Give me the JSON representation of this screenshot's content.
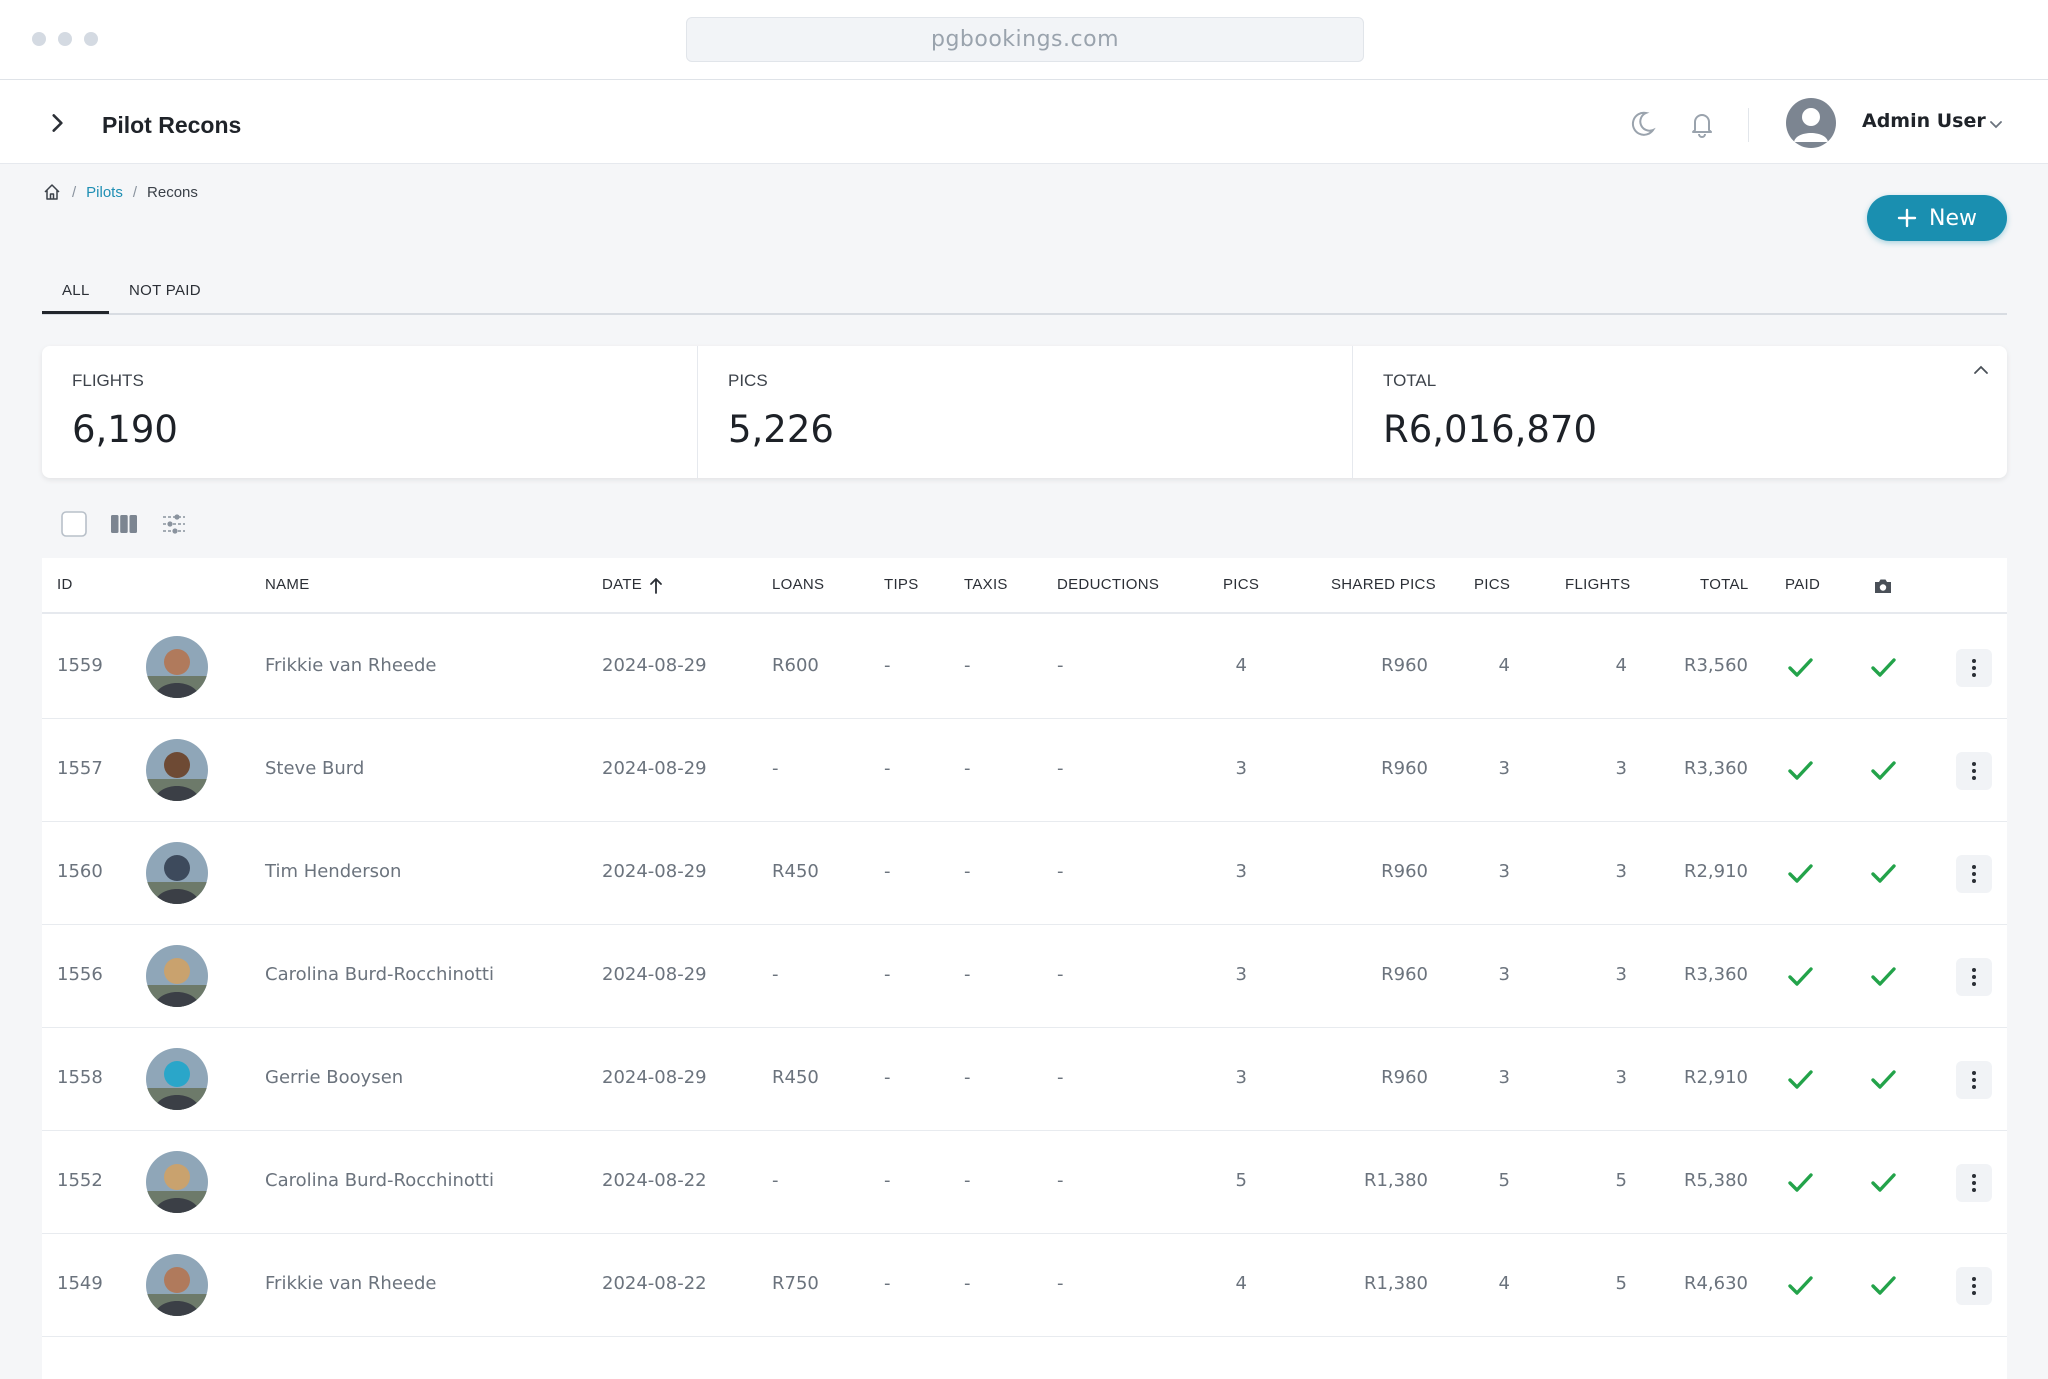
{
  "browser": {
    "url": "pgbookings.com"
  },
  "header": {
    "title": "Pilot Recons",
    "user_name": "Admin User"
  },
  "breadcrumb": {
    "pilots": "Pilots",
    "recons": "Recons",
    "separator": "/"
  },
  "actions": {
    "new_label": "New"
  },
  "tabs": [
    {
      "label": "ALL"
    },
    {
      "label": "NOT PAID"
    }
  ],
  "stats": [
    {
      "label": "FLIGHTS",
      "value": "6,190"
    },
    {
      "label": "PICS",
      "value": "5,226"
    },
    {
      "label": "TOTAL",
      "value": "R6,016,870"
    }
  ],
  "table": {
    "columns": {
      "id": "ID",
      "name": "NAME",
      "date": "DATE",
      "loans": "LOANS",
      "tips": "TIPS",
      "taxis": "TAXIS",
      "deductions": "DEDUCTIONS",
      "pics": "PICS",
      "shared_pics": "SHARED PICS",
      "pics2": "PICS",
      "flights": "FLIGHTS",
      "total": "TOTAL",
      "paid": "PAID"
    },
    "rows": [
      {
        "id": "1559",
        "name": "Frikkie van Rheede",
        "date": "2024-08-29",
        "loans": "R600",
        "tips": "-",
        "taxis": "-",
        "deductions": "-",
        "pics": "4",
        "shared_pics": "R960",
        "pics2": "4",
        "flights": "4",
        "total": "R3,560",
        "photo_color": "#b07a5c"
      },
      {
        "id": "1557",
        "name": "Steve Burd",
        "date": "2024-08-29",
        "loans": "-",
        "tips": "-",
        "taxis": "-",
        "deductions": "-",
        "pics": "3",
        "shared_pics": "R960",
        "pics2": "3",
        "flights": "3",
        "total": "R3,360",
        "photo_color": "#6e4a34"
      },
      {
        "id": "1560",
        "name": "Tim Henderson",
        "date": "2024-08-29",
        "loans": "R450",
        "tips": "-",
        "taxis": "-",
        "deductions": "-",
        "pics": "3",
        "shared_pics": "R960",
        "pics2": "3",
        "flights": "3",
        "total": "R2,910",
        "photo_color": "#3d4a5c"
      },
      {
        "id": "1556",
        "name": "Carolina Burd-Rocchinotti",
        "date": "2024-08-29",
        "loans": "-",
        "tips": "-",
        "taxis": "-",
        "deductions": "-",
        "pics": "3",
        "shared_pics": "R960",
        "pics2": "3",
        "flights": "3",
        "total": "R3,360",
        "photo_color": "#c9a26e"
      },
      {
        "id": "1558",
        "name": "Gerrie Booysen",
        "date": "2024-08-29",
        "loans": "R450",
        "tips": "-",
        "taxis": "-",
        "deductions": "-",
        "pics": "3",
        "shared_pics": "R960",
        "pics2": "3",
        "flights": "3",
        "total": "R2,910",
        "photo_color": "#2aa6c9"
      },
      {
        "id": "1552",
        "name": "Carolina Burd-Rocchinotti",
        "date": "2024-08-22",
        "loans": "-",
        "tips": "-",
        "taxis": "-",
        "deductions": "-",
        "pics": "5",
        "shared_pics": "R1,380",
        "pics2": "5",
        "flights": "5",
        "total": "R5,380",
        "photo_color": "#c9a26e"
      },
      {
        "id": "1549",
        "name": "Frikkie van Rheede",
        "date": "2024-08-22",
        "loans": "R750",
        "tips": "-",
        "taxis": "-",
        "deductions": "-",
        "pics": "4",
        "shared_pics": "R1,380",
        "pics2": "4",
        "flights": "5",
        "total": "R4,630",
        "photo_color": "#b07a5c"
      }
    ]
  },
  "colors": {
    "accent": "#1a8fb0",
    "check": "#23a34a",
    "link": "#1f8fb4"
  }
}
